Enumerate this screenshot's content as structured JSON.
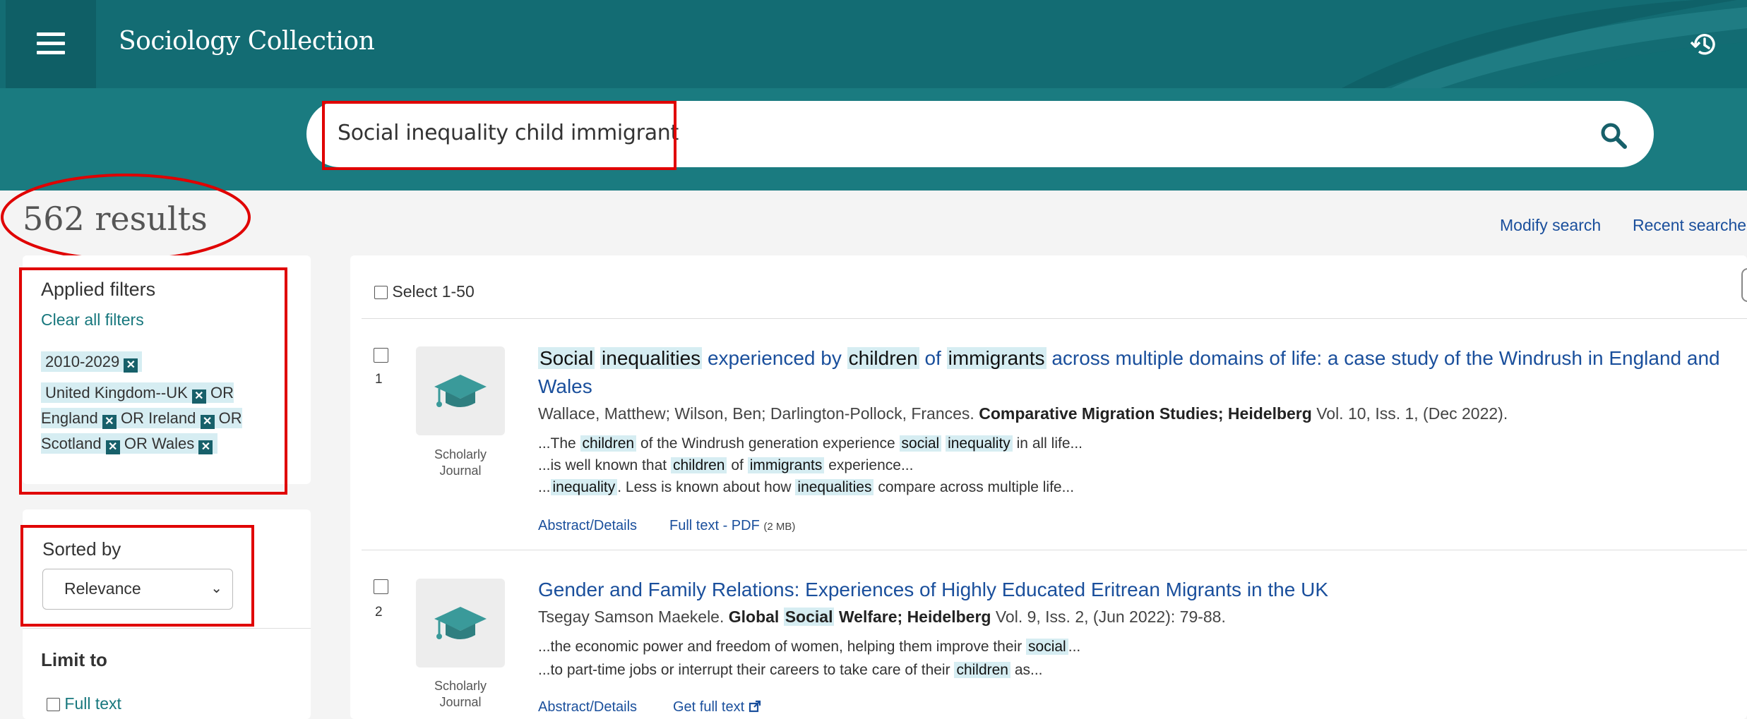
{
  "header": {
    "app_title": "Sociology Collection",
    "menu_icon": "hamburger-menu-icon",
    "history_icon": "history-icon"
  },
  "search": {
    "query": "Social inequality child immigrant",
    "search_icon": "search-icon"
  },
  "results": {
    "count_label": "562 results",
    "modify_search": "Modify search",
    "recent_searches": "Recent searche",
    "select_label": "Select 1-50"
  },
  "filters": {
    "title": "Applied filters",
    "clear_all": "Clear all filters",
    "date_range": "2010-2029",
    "location": {
      "uk": "United Kingdom--UK",
      "or1": "OR",
      "england": "England",
      "or2": "OR Ireland",
      "or3": "OR",
      "scotland": "Scotland",
      "or4": "OR Wales"
    }
  },
  "sort": {
    "label": "Sorted by",
    "selected": "Relevance"
  },
  "limit": {
    "title": "Limit to",
    "full_text": "Full text"
  },
  "items": [
    {
      "number": "1",
      "type_line1": "Scholarly",
      "type_line2": "Journal",
      "title": {
        "w1": "Social",
        "w2": "inequalities",
        "t1": "experienced by",
        "w3": "children",
        "t2": "of",
        "w4": "immigrants",
        "t3": "across multiple domains of life: a case study of the Windrush in England and",
        "t4": "Wales"
      },
      "meta": {
        "authors": "Wallace, Matthew; Wilson, Ben; Darlington-Pollock, Frances.",
        "source": "Comparative Migration Studies; Heidelberg",
        "details": "Vol. 10, Iss. 1,  (Dec 2022)."
      },
      "snippets": {
        "s1a": "...The",
        "s1k1": "children",
        "s1b": "of the Windrush generation experience",
        "s1k2": "social",
        "s1k3": "inequality",
        "s1c": "in all life...",
        "s2a": "...is well known that",
        "s2k1": "children",
        "s2b": "of",
        "s2k2": "immigrants",
        "s2c": "experience...",
        "s3a": "...",
        "s3k1": "inequality",
        "s3b": ". Less is known about how",
        "s3k2": "inequalities",
        "s3c": "compare across multiple life..."
      },
      "link1": "Abstract/Details",
      "link2": "Full text - PDF",
      "link2_size": "(2 MB)"
    },
    {
      "number": "2",
      "type_line1": "Scholarly",
      "type_line2": "Journal",
      "title": "Gender and Family Relations: Experiences of Highly Educated Eritrean Migrants in the UK",
      "meta": {
        "authors": "Tsegay Samson Maekele.",
        "source1": "Global",
        "source_kw": "Social",
        "source2": "Welfare; Heidelberg",
        "details": "Vol. 9, Iss. 2,  (Jun 2022): 79-88."
      },
      "snippets": {
        "s1a": "...the economic power and freedom of women, helping them improve their",
        "s1k1": "social",
        "s1b": "...",
        "s2a": "...to part-time jobs or interrupt their careers to take care of their",
        "s2k1": "children",
        "s2b": "as..."
      },
      "link1": "Abstract/Details",
      "link2": "Get full text"
    }
  ],
  "colors": {
    "header_bg": "#136c73",
    "search_band": "#1a7b80",
    "link": "#1a4f9c",
    "keyword_highlight": "#d6edf2",
    "annotation_red": "#e00000"
  }
}
